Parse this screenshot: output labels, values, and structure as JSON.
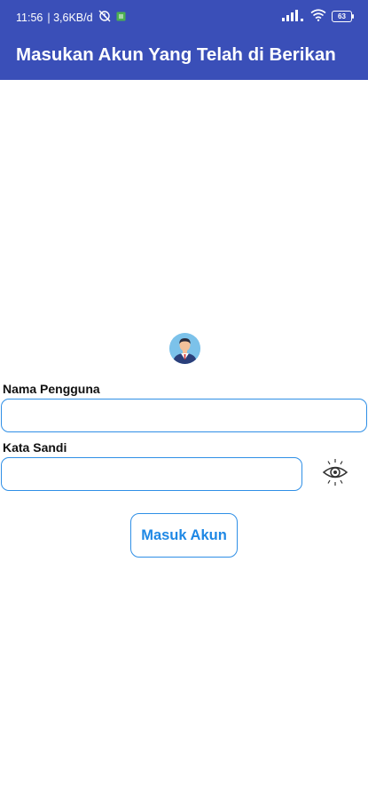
{
  "status_bar": {
    "time": "11:56",
    "network_speed": "| 3,6KB/d",
    "battery": "63",
    "icons": [
      "alarm-off-icon",
      "sim-icon",
      "signal-icon",
      "wifi-icon",
      "battery-icon"
    ]
  },
  "app_bar": {
    "title": "Masukan Akun Yang Telah di Berikan",
    "color": "#3a4fb8"
  },
  "form": {
    "avatar_icon": "user-avatar-icon",
    "username_label": "Nama Pengguna",
    "username_value": "",
    "password_label": "Kata Sandi",
    "password_value": "",
    "toggle_icon": "eye-icon",
    "submit_label": "Masuk Akun",
    "accent_color": "#2f8fe6"
  }
}
